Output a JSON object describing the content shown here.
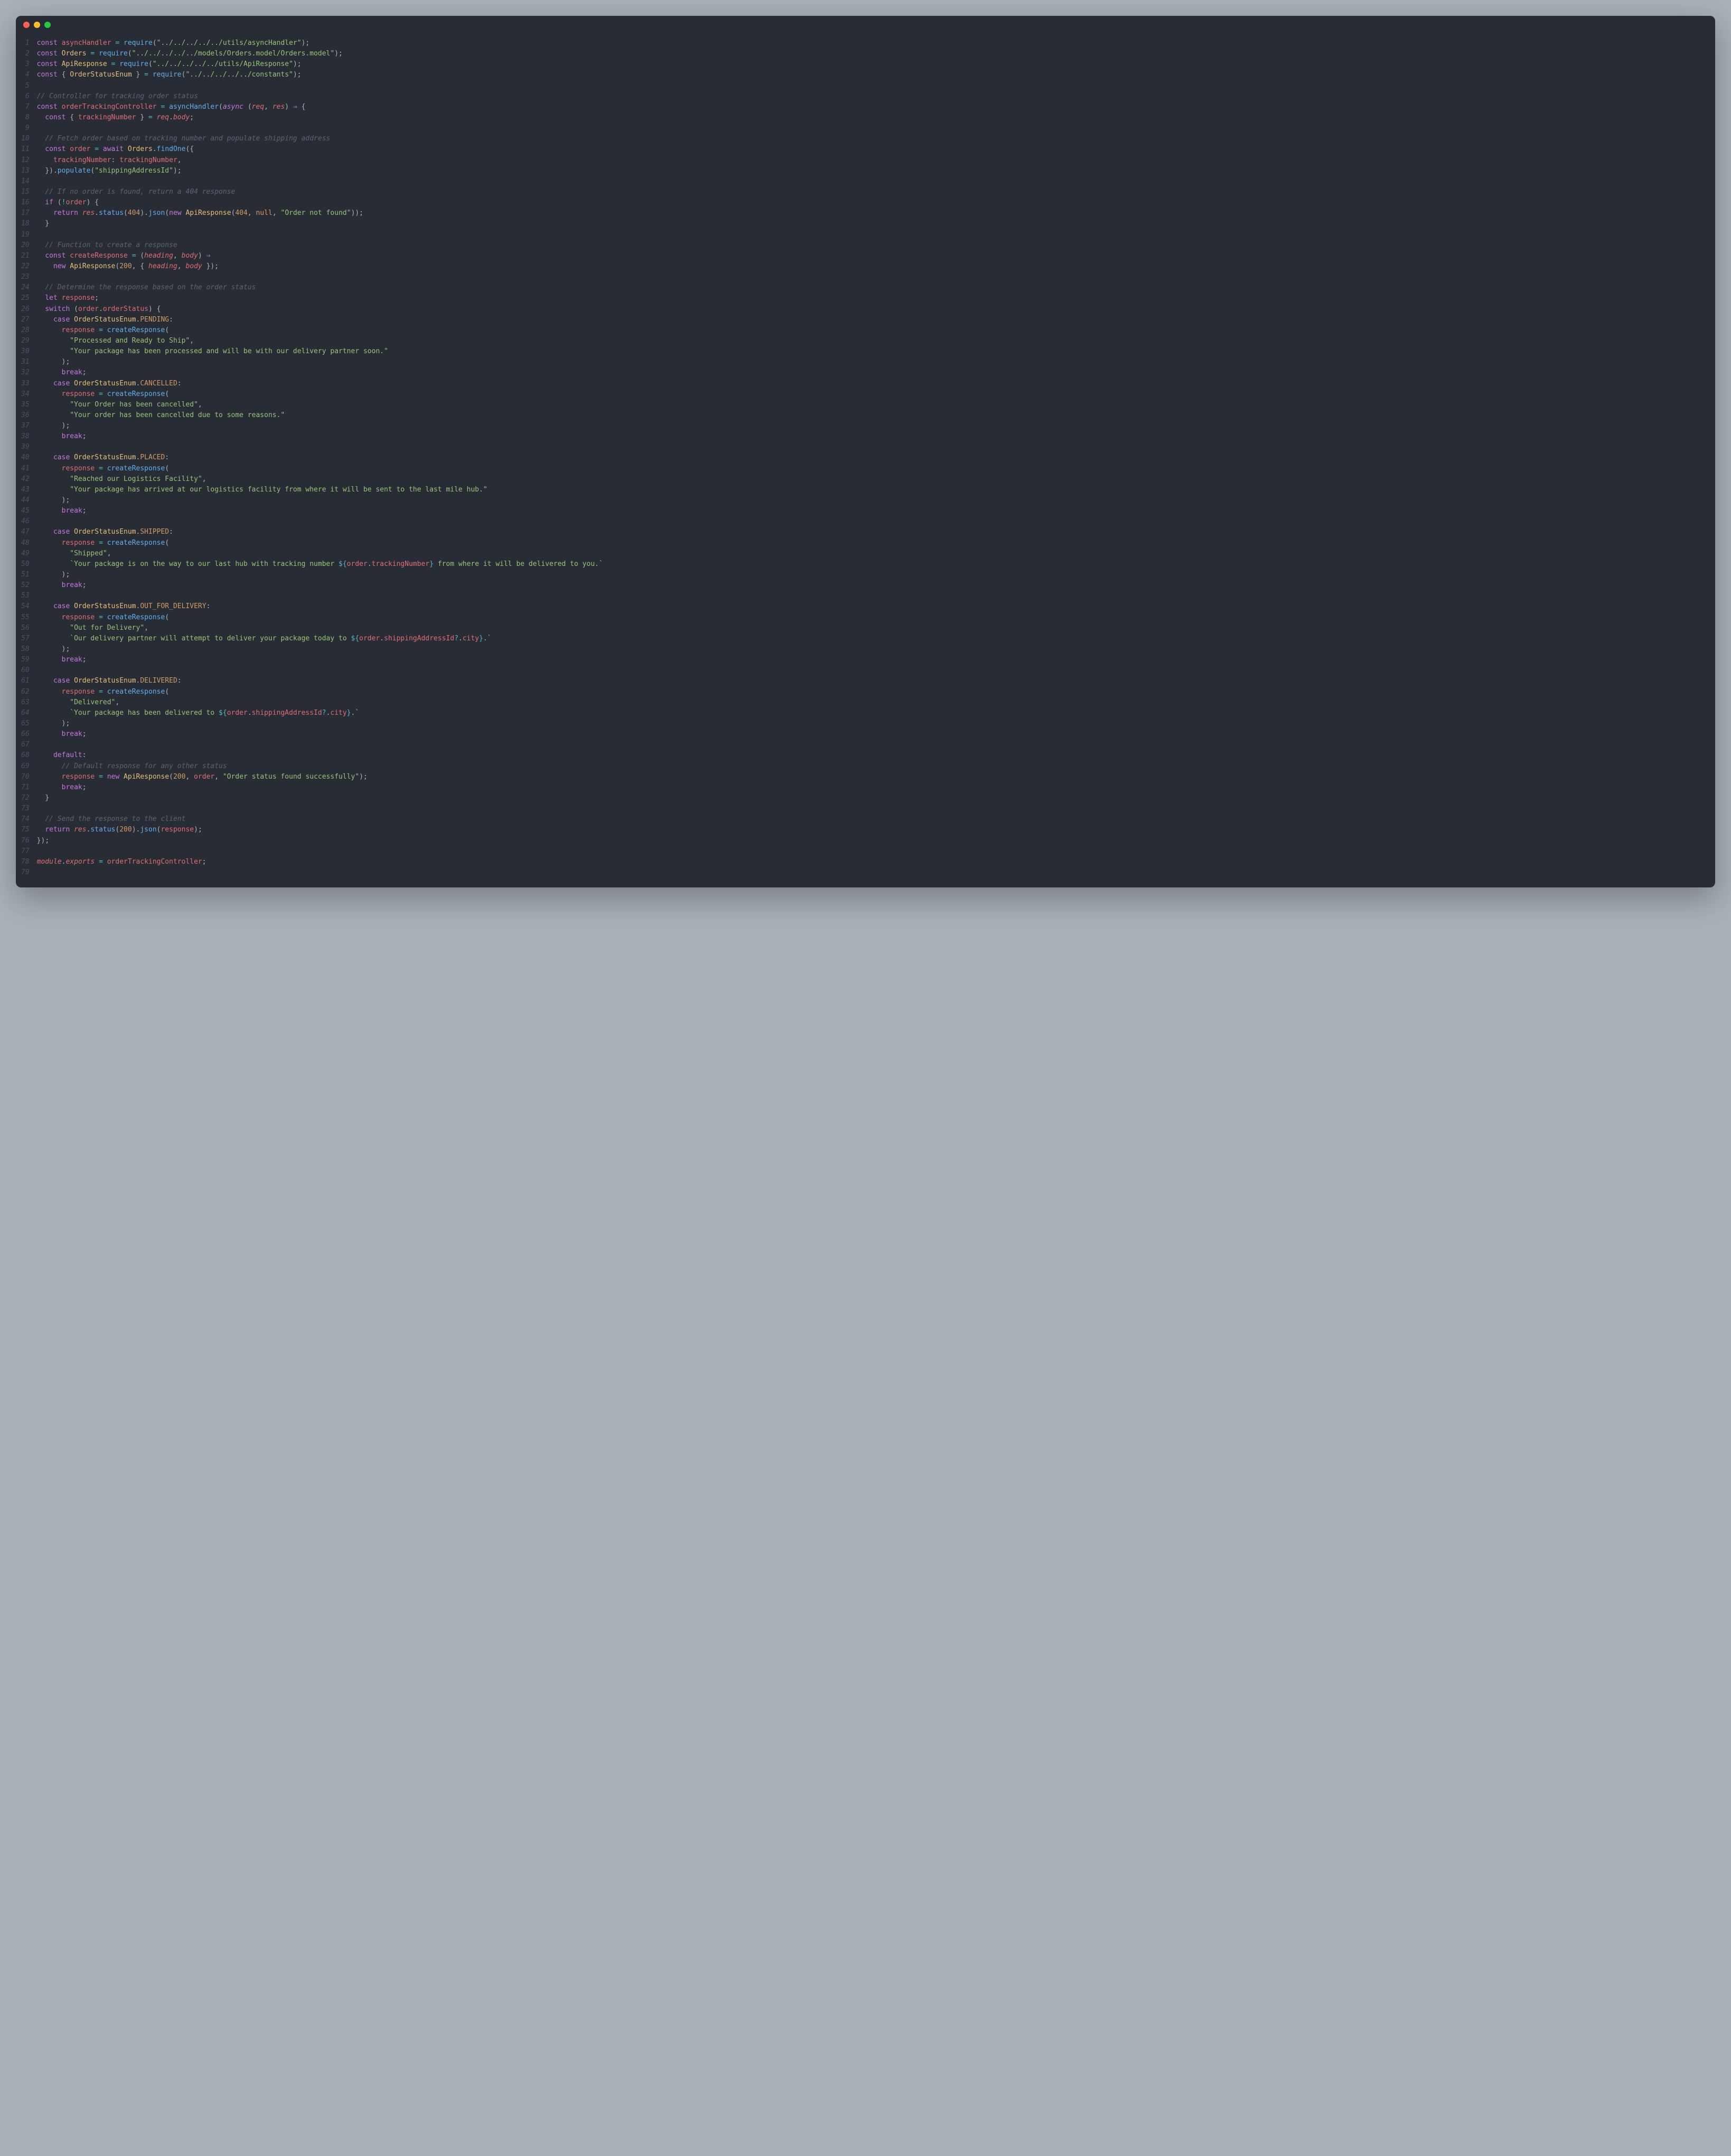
{
  "window": {
    "trafficLights": [
      "close",
      "minimize",
      "zoom"
    ]
  },
  "code": {
    "language": "javascript",
    "lineCount": 79,
    "lines": [
      "const asyncHandler = require(\"../../../../../utils/asyncHandler\");",
      "const Orders = require(\"../../../../../models/Orders.model/Orders.model\");",
      "const ApiResponse = require(\"../../../../../utils/ApiResponse\");",
      "const { OrderStatusEnum } = require(\"../../../../../constants\");",
      "",
      "// Controller for tracking order status",
      "const orderTrackingController = asyncHandler(async (req, res) => {",
      "  const { trackingNumber } = req.body;",
      "",
      "  // Fetch order based on tracking number and populate shipping address",
      "  const order = await Orders.findOne({",
      "    trackingNumber: trackingNumber,",
      "  }).populate(\"shippingAddressId\");",
      "",
      "  // If no order is found, return a 404 response",
      "  if (!order) {",
      "    return res.status(404).json(new ApiResponse(404, null, \"Order not found\"));",
      "  }",
      "",
      "  // Function to create a response",
      "  const createResponse = (heading, body) =>",
      "    new ApiResponse(200, { heading, body });",
      "",
      "  // Determine the response based on the order status",
      "  let response;",
      "  switch (order.orderStatus) {",
      "    case OrderStatusEnum.PENDING:",
      "      response = createResponse(",
      "        \"Processed and Ready to Ship\",",
      "        \"Your package has been processed and will be with our delivery partner soon.\"",
      "      );",
      "      break;",
      "    case OrderStatusEnum.CANCELLED:",
      "      response = createResponse(",
      "        \"Your Order has been cancelled\",",
      "        \"Your order has been cancelled due to some reasons.\"",
      "      );",
      "      break;",
      "",
      "    case OrderStatusEnum.PLACED:",
      "      response = createResponse(",
      "        \"Reached our Logistics Facility\",",
      "        \"Your package has arrived at our logistics facility from where it will be sent to the last mile hub.\"",
      "      );",
      "      break;",
      "",
      "    case OrderStatusEnum.SHIPPED:",
      "      response = createResponse(",
      "        \"Shipped\",",
      "        `Your package is on the way to our last hub with tracking number ${order.trackingNumber} from where it will be delivered to you.`",
      "      );",
      "      break;",
      "",
      "    case OrderStatusEnum.OUT_FOR_DELIVERY:",
      "      response = createResponse(",
      "        \"Out for Delivery\",",
      "        `Our delivery partner will attempt to deliver your package today to ${order.shippingAddressId?.city}.`",
      "      );",
      "      break;",
      "",
      "    case OrderStatusEnum.DELIVERED:",
      "      response = createResponse(",
      "        \"Delivered\",",
      "        `Your package has been delivered to ${order.shippingAddressId?.city}.`",
      "      );",
      "      break;",
      "",
      "    default:",
      "      // Default response for any other status",
      "      response = new ApiResponse(200, order, \"Order status found successfully\");",
      "      break;",
      "  }",
      "",
      "  // Send the response to the client",
      "  return res.status(200).json(response);",
      "});",
      "",
      "module.exports = orderTrackingController;",
      ""
    ]
  }
}
